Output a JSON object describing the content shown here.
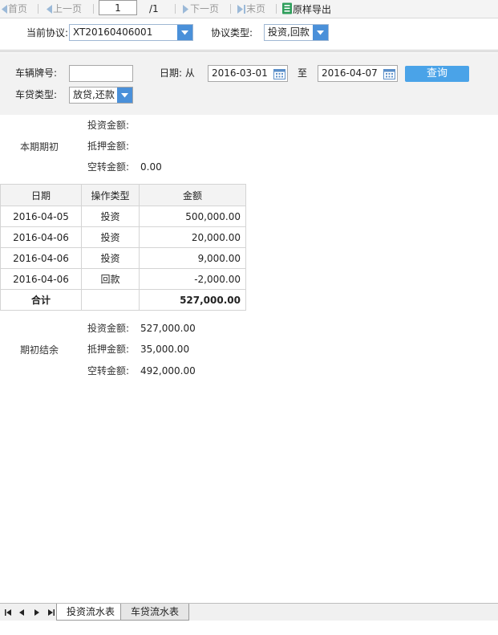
{
  "toolbar": {
    "first": "首页",
    "prev": "上一页",
    "page_value": "1",
    "page_total": "/1",
    "next": "下一页",
    "last": "末页",
    "export": "原样导出"
  },
  "protocol": {
    "current_label": "当前协议:",
    "current_value": "XT20160406001",
    "type_label": "协议类型:",
    "type_value": "投资,回款"
  },
  "filter": {
    "plate_label": "车辆牌号:",
    "plate_value": "",
    "date_label": "日期: 从",
    "date_from": "2016-03-01",
    "to_label": "至",
    "date_to": "2016-04-07",
    "loan_type_label": "车贷类型:",
    "loan_type_value": "放贷,还款",
    "query_button": "查询"
  },
  "opening": {
    "title": "本期期初",
    "invest_label": "投资金额:",
    "invest_value": "",
    "mortgage_label": "抵押金额:",
    "mortgage_value": "",
    "idle_label": "空转金额:",
    "idle_value": "0.00"
  },
  "table": {
    "headers": [
      "日期",
      "操作类型",
      "金额"
    ],
    "rows": [
      [
        "2016-04-05",
        "投资",
        "500,000.00"
      ],
      [
        "2016-04-06",
        "投资",
        "20,000.00"
      ],
      [
        "2016-04-06",
        "投资",
        "9,000.00"
      ],
      [
        "2016-04-06",
        "回款",
        "-2,000.00"
      ]
    ],
    "total_label": "合计",
    "total_value": "527,000.00"
  },
  "closing": {
    "title": "期初结余",
    "invest_label": "投资金额:",
    "invest_value": "527,000.00",
    "mortgage_label": "抵押金额:",
    "mortgage_value": "35,000.00",
    "idle_label": "空转金额:",
    "idle_value": "492,000.00"
  },
  "sheets": {
    "tab1": "投资流水表",
    "tab2": "车贷流水表"
  },
  "colors": {
    "accent": "#4a90d9",
    "query_button": "#4aa3e8",
    "panel_bg": "#f2f2f2"
  }
}
